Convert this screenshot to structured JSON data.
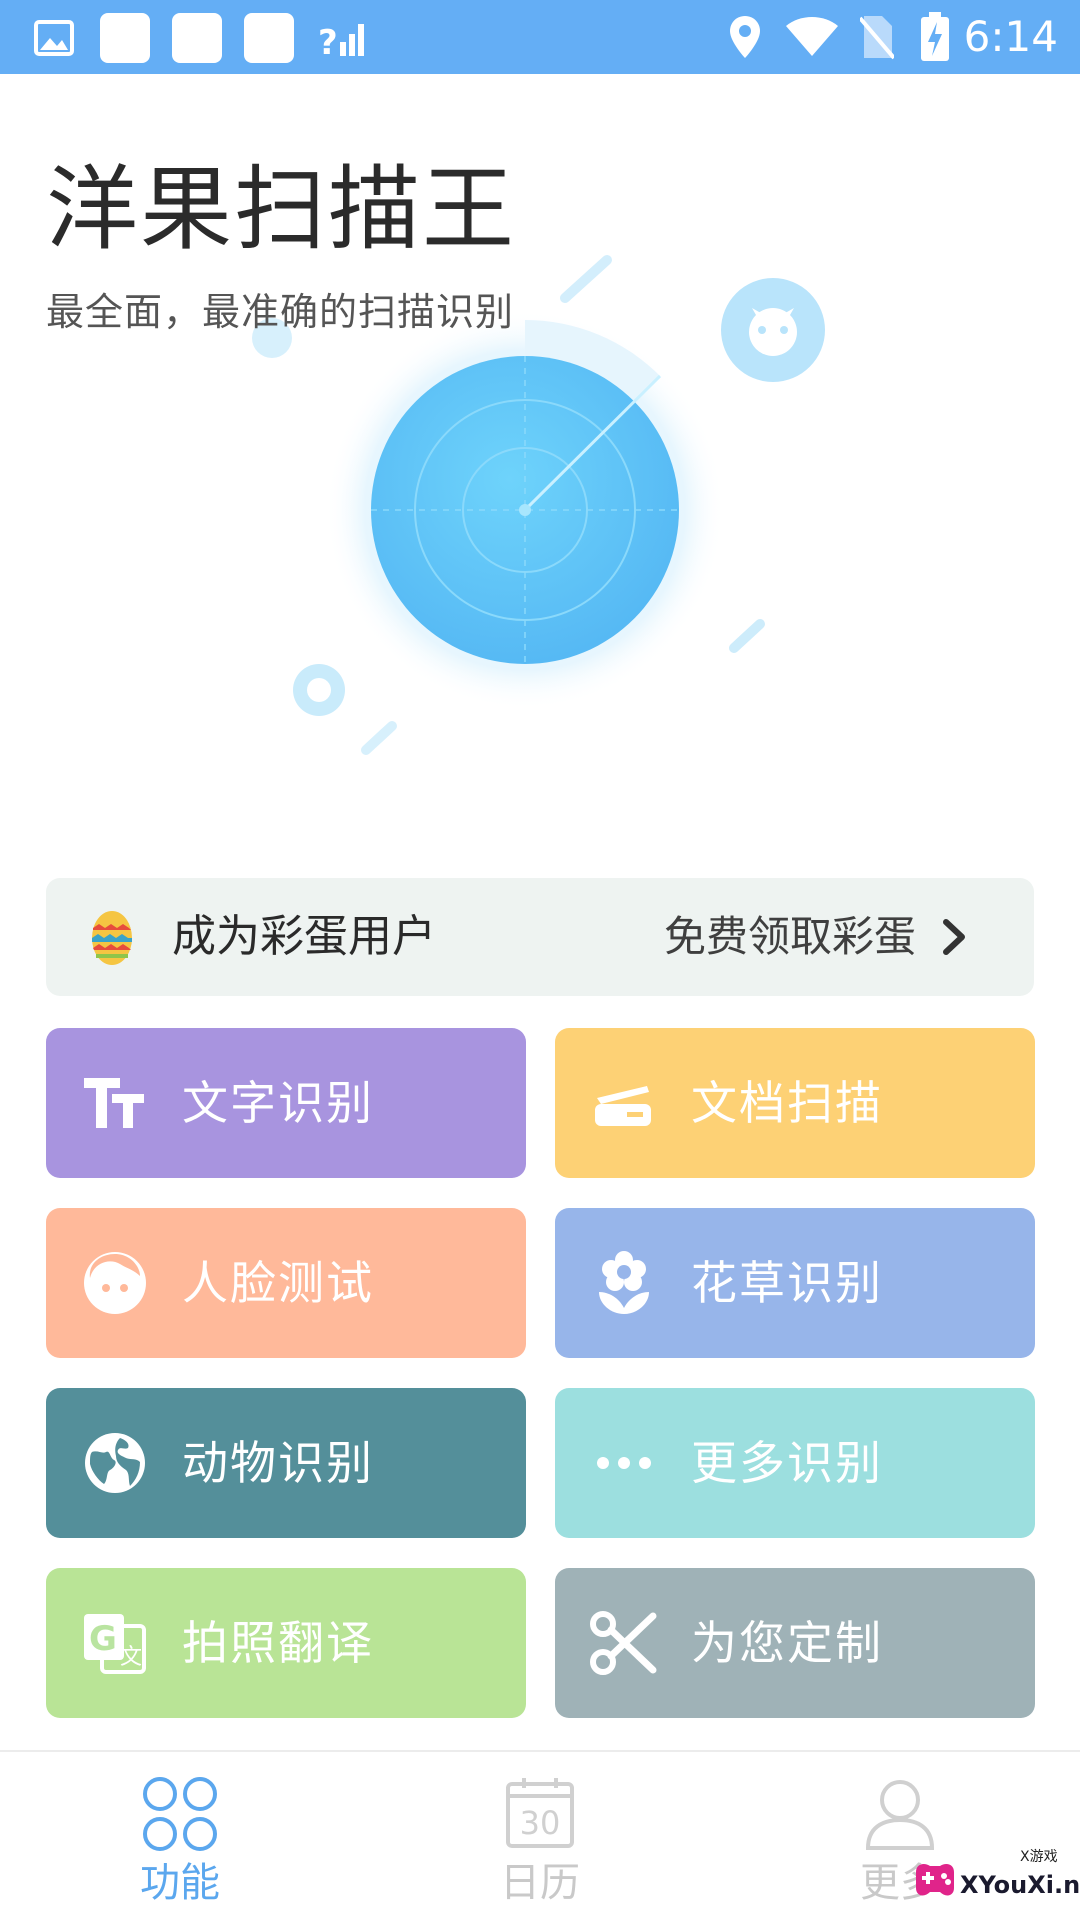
{
  "status_bar": {
    "time": "6:14",
    "icons": [
      "gallery-icon",
      "app-icon",
      "app-icon",
      "app-icon",
      "signal-icon",
      "location-icon",
      "wifi-icon",
      "no-sim-icon",
      "battery-charging-icon"
    ]
  },
  "header": {
    "title": "洋果扫描王",
    "subtitle": "最全面，最准确的扫描识别"
  },
  "egg_banner": {
    "title": "成为彩蛋用户",
    "action": "免费领取彩蛋",
    "icon": "easter-egg-icon"
  },
  "features": [
    {
      "label": "文字识别",
      "icon": "text-recognition-icon",
      "color": "#a894df"
    },
    {
      "label": "文档扫描",
      "icon": "document-scan-icon",
      "color": "#fdd175"
    },
    {
      "label": "人脸测试",
      "icon": "face-icon",
      "color": "#ffb99a"
    },
    {
      "label": "花草识别",
      "icon": "flower-icon",
      "color": "#97b5ea"
    },
    {
      "label": "动物识别",
      "icon": "globe-icon",
      "color": "#548f9a"
    },
    {
      "label": "更多识别",
      "icon": "more-dots-icon",
      "color": "#9cdfdf"
    },
    {
      "label": "拍照翻译",
      "icon": "translate-icon",
      "color": "#b9e496"
    },
    {
      "label": "为您定制",
      "icon": "scissors-icon",
      "color": "#9fb2b7"
    }
  ],
  "bottom_nav": [
    {
      "label": "功能",
      "icon": "grid-icon",
      "active": true
    },
    {
      "label": "日历",
      "icon": "calendar-icon",
      "active": false
    },
    {
      "label": "更多",
      "icon": "profile-icon",
      "active": false
    }
  ],
  "calendar_icon_number": "30",
  "watermark": {
    "text": "XYouXi.net",
    "small": "X游戏"
  },
  "colors": {
    "status_bar": "#64aef5",
    "accent": "#5ba7ee",
    "radar": "#5ec4f7"
  }
}
